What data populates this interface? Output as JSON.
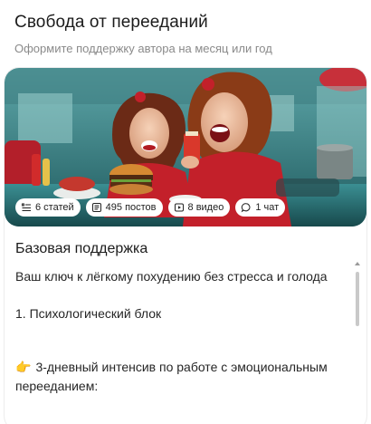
{
  "header": {
    "title": "Свобода от перееданий",
    "subtitle": "Оформите поддержку автора на месяц или год"
  },
  "cover": {
    "alt_icon": "cover-image",
    "stats": [
      {
        "icon": "articles-icon",
        "label": "6 статей"
      },
      {
        "icon": "posts-icon",
        "label": "495 постов"
      },
      {
        "icon": "video-icon",
        "label": "8 видео"
      },
      {
        "icon": "chat-icon",
        "label": "1 чат"
      }
    ]
  },
  "plan": {
    "title": "Базовая поддержка",
    "lines": [
      "Ваш ключ к лёгкому похудению без стресса и голода",
      "1. Психологический блок",
      "3-дневный интенсив по работе с эмоциональным перееданием:"
    ],
    "hand_emoji": "👉"
  },
  "colors": {
    "accent_red": "#c8202a",
    "teal_bg": "#2d6f73"
  }
}
